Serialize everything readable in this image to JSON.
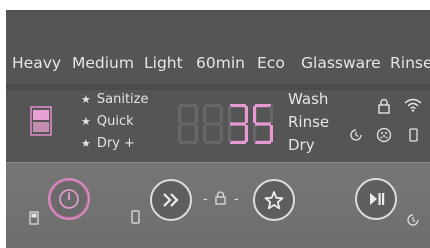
{
  "programs": [
    "Heavy",
    "Medium",
    "Light",
    "60min",
    "Eco",
    "Glassware",
    "Rinse"
  ],
  "options": [
    "Sanitize",
    "Quick",
    "Dry +"
  ],
  "display": {
    "digits": "35"
  },
  "phases": [
    "Wash",
    "Rinse",
    "Dry"
  ],
  "icons": {
    "lock": "lock-icon",
    "wifi": "wifi-icon",
    "delay": "delay-clock-icon",
    "rinse_aid": "rinse-aid-icon",
    "phone": "phone-icon",
    "detergent": "detergent-icon",
    "remote": "remote-icon",
    "delay_start": "delay-start-icon"
  },
  "colors": {
    "display_pink": "#e79ad2",
    "panel": "#555555",
    "power_ring": "#d98bc0"
  },
  "separator": {
    "left": "-",
    "right": "-"
  }
}
